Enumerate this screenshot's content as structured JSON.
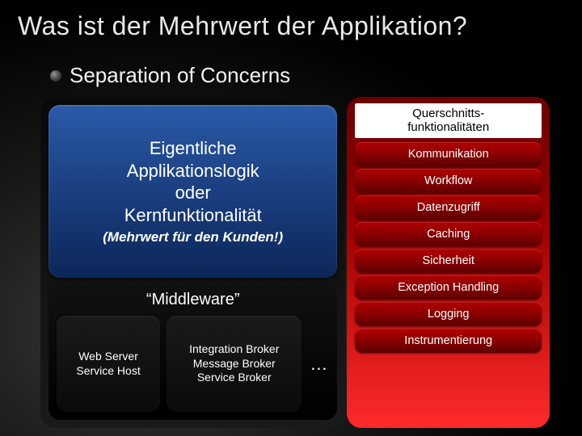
{
  "title": "Was ist der Mehrwert der Applikation?",
  "subtitle": "Separation of Concerns",
  "core": {
    "line1": "Eigentliche",
    "line2": "Applikationslogik",
    "line3": "oder",
    "line4": "Kernfunktionalität",
    "sub": "(Mehrwert für den Kunden!)"
  },
  "middleware": {
    "title": "“Middleware”",
    "items": {
      "a": "Web Server\nService Host",
      "b": "Integration Broker\nMessage Broker\nService Broker"
    },
    "ellipsis": "…"
  },
  "right": {
    "header": "Querschnitts-\nfunktionalitäten",
    "items": [
      "Kommunikation",
      "Workflow",
      "Datenzugriff",
      "Caching",
      "Sicherheit",
      "Exception Handling",
      "Logging",
      "Instrumentierung"
    ]
  }
}
